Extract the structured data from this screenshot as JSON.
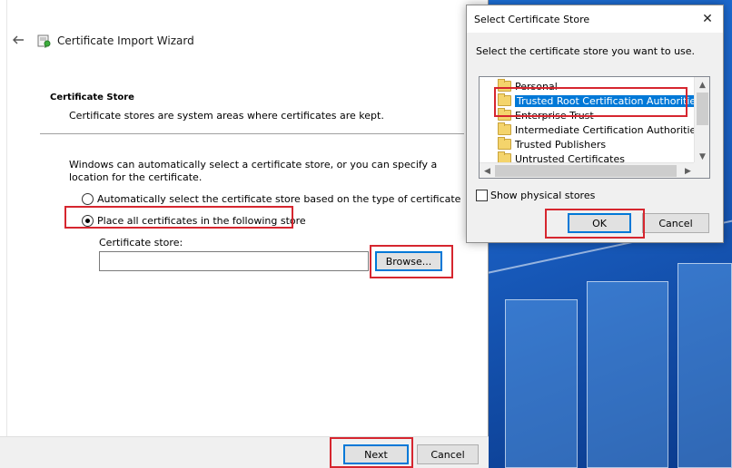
{
  "wizard": {
    "title": "Certificate Import Wizard",
    "section_title": "Certificate Store",
    "section_desc": "Certificate stores are system areas where certificates are kept.",
    "info_text": "Windows can automatically select a certificate store, or you can specify a location for the certificate.",
    "radio_auto_label": "Automatically select the certificate store based on the type of certificate",
    "radio_place_label": "Place all certificates in the following store",
    "radio_selected": "place",
    "store_label": "Certificate store:",
    "store_value": "",
    "browse_label": "Browse...",
    "next_label": "Next",
    "cancel_label": "Cancel"
  },
  "dialog": {
    "title": "Select Certificate Store",
    "close_glyph": "✕",
    "prompt": "Select the certificate store you want to use.",
    "stores": [
      {
        "label": "Personal"
      },
      {
        "label": "Trusted Root Certification Authorities",
        "selected": true
      },
      {
        "label": "Enterprise Trust"
      },
      {
        "label": "Intermediate Certification Authorities"
      },
      {
        "label": "Trusted Publishers"
      },
      {
        "label": "Untrusted Certificates"
      }
    ],
    "show_physical_label": "Show physical stores",
    "show_physical_checked": false,
    "ok_label": "OK",
    "cancel_label": "Cancel"
  },
  "colors": {
    "highlight": "#d6262f",
    "selection": "#0078d7"
  }
}
